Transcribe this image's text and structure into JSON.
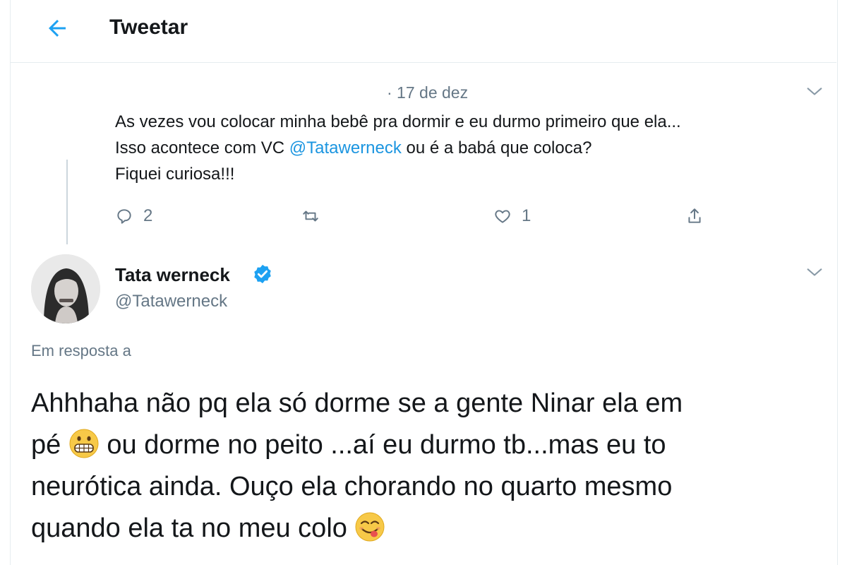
{
  "header": {
    "title": "Tweetar",
    "back_icon": "arrow-left-icon",
    "accent_color": "#1da1f2"
  },
  "parent_tweet": {
    "date": "· 17 de dez",
    "text_line1": "As vezes vou colocar minha bebê pra dormir e eu durmo primeiro que ela...",
    "text_line2_before": "Isso acontece com VC ",
    "mention": "@Tatawerneck",
    "text_line2_after": " ou é a babá que coloca?",
    "text_line3": "Fiquei curiosa!!!",
    "reply_count": "2",
    "like_count": "1",
    "icons": [
      "reply-icon",
      "retweet-icon",
      "like-icon",
      "share-icon",
      "chevron-down-icon"
    ]
  },
  "reply_tweet": {
    "author_name": "Tata werneck",
    "author_handle": "@Tatawerneck",
    "verified_color": "#1da1f2",
    "in_reply_to": "Em resposta a",
    "line1": "Ahhhaha não pq ela só dorme se a gente Ninar ela em",
    "line2_a": "pé ",
    "line2_b": " ou dorme no peito ...aí eu durmo tb...mas eu to",
    "line3": "neurótica ainda. Ouço ela chorando no quarto mesmo",
    "line4": "quando ela ta no meu colo ",
    "emojis": [
      "grimacing-face-emoji",
      "face-savoring-food-emoji"
    ]
  },
  "colors": {
    "text": "#14171a",
    "secondary": "#657786",
    "link": "#1b95e0",
    "border": "#e6ecf0"
  }
}
